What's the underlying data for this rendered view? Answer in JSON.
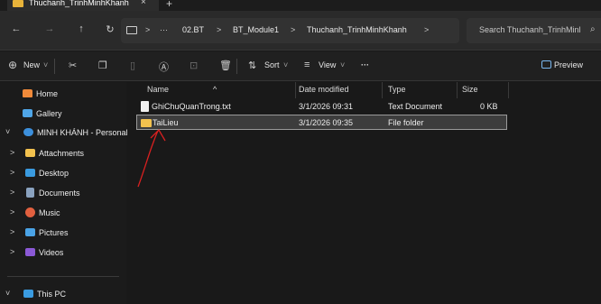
{
  "tab": {
    "title": "Thuchanh_TrinhMinhKhanh",
    "close": "×",
    "new": "+"
  },
  "nav": {
    "back": "←",
    "forward": "→",
    "up": "↑",
    "refresh": "↻",
    "more": "···",
    "breadcrumbs": [
      "02.BT",
      "BT_Module1",
      "Thuchanh_TrinhMinhKhanh"
    ],
    "sep": ">",
    "search_placeholder": "Search Thuchanh_TrinhMinl",
    "search_icon": "⌕"
  },
  "commands": {
    "new": "New",
    "sort": "Sort",
    "view": "View",
    "more": "···",
    "preview": "Preview",
    "dropdown": "˅"
  },
  "sidebar": {
    "items": [
      {
        "label": "Home",
        "icon": "home-icon",
        "color": "#f08a3a"
      },
      {
        "label": "Gallery",
        "icon": "gallery-icon",
        "color": "#4fa6e8"
      },
      {
        "label": "MINH KHÁNH - Personal",
        "icon": "cloud-icon",
        "color": "#3c8fdc"
      },
      {
        "label": "Attachments",
        "icon": "folder-icon",
        "color": "#f2c14e"
      },
      {
        "label": "Desktop",
        "icon": "desktop-icon",
        "color": "#3a9be0"
      },
      {
        "label": "Documents",
        "icon": "documents-icon",
        "color": "#8aa2bf"
      },
      {
        "label": "Music",
        "icon": "music-icon",
        "color": "#e2603f"
      },
      {
        "label": "Pictures",
        "icon": "pictures-icon",
        "color": "#4aa3e6"
      },
      {
        "label": "Videos",
        "icon": "videos-icon",
        "color": "#8b59d6"
      },
      {
        "label": "This PC",
        "icon": "pc-icon",
        "color": "#3a9be0"
      }
    ]
  },
  "columns": {
    "name": "Name",
    "date": "Date modified",
    "type": "Type",
    "size": "Size"
  },
  "files": [
    {
      "name": "GhiChuQuanTrong.txt",
      "date": "3/1/2026 09:31",
      "type": "Text Document",
      "size": "0 KB"
    },
    {
      "name": "TaiLieu",
      "date": "3/1/2026 09:35",
      "type": "File folder",
      "size": ""
    }
  ]
}
